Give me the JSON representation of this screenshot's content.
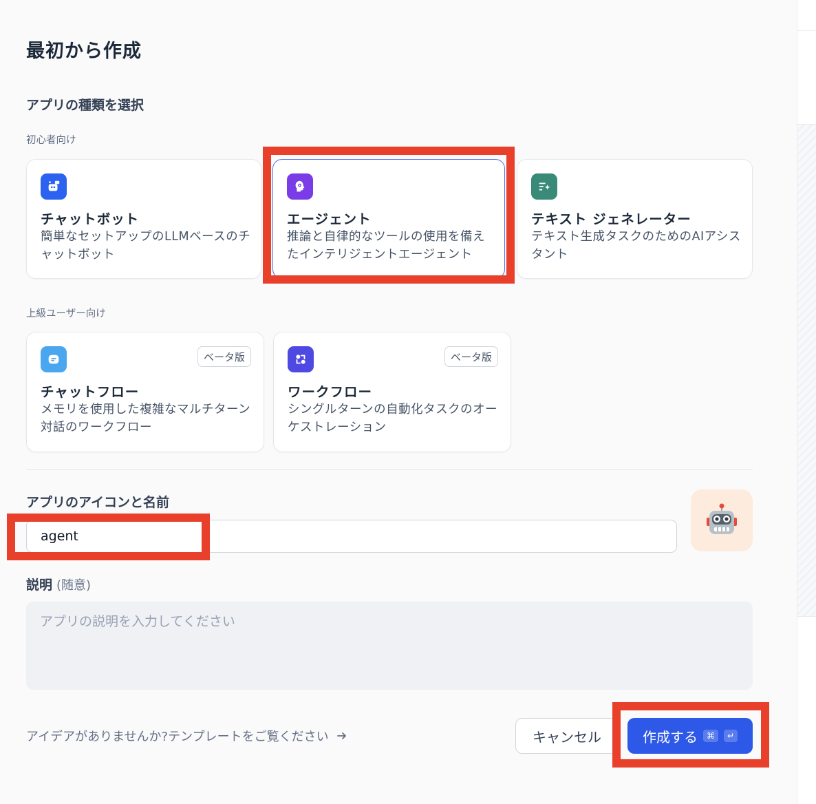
{
  "page": {
    "title": "最初から作成"
  },
  "app_type": {
    "heading": "アプリの種類を選択",
    "beginner_label": "初心者向け",
    "advanced_label": "上級ユーザー向け",
    "beginner_cards": [
      {
        "name": "チャットボット",
        "desc": "簡単なセットアップのLLMベースのチャットボット",
        "icon": "chatbot-icon",
        "color": "#2b63f0"
      },
      {
        "name": "エージェント",
        "desc": "推論と自律的なツールの使用を備えたインテリジェントエージェント",
        "icon": "agent-brain-icon",
        "color": "#7a3ce6"
      },
      {
        "name": "テキスト ジェネレーター",
        "desc": "テキスト生成タスクのためのAIアシスタント",
        "icon": "text-generator-icon",
        "color": "#3a8a7a"
      }
    ],
    "advanced_cards": [
      {
        "name": "チャットフロー",
        "desc": "メモリを使用した複雑なマルチターン対話のワークフロー",
        "badge": "ベータ版",
        "icon": "chatflow-icon",
        "color": "#4aa6ef"
      },
      {
        "name": "ワークフロー",
        "desc": "シングルターンの自動化タスクのオーケストレーション",
        "badge": "ベータ版",
        "icon": "workflow-icon",
        "color": "#4f49e3"
      }
    ]
  },
  "name_section": {
    "heading": "アプリのアイコンと名前",
    "value": "agent",
    "avatar_icon": "robot-emoji-icon",
    "avatar_emoji": "🤖"
  },
  "description": {
    "label": "説明",
    "optional": "(随意)",
    "placeholder": "アプリの説明を入力してください"
  },
  "footer": {
    "template_link": "アイデアがありませんか?テンプレートをご覧ください",
    "cancel": "キャンセル",
    "create": "作成する",
    "kbd_cmd": "⌘",
    "kbd_enter": "↵"
  },
  "colors": {
    "accent": "#2d58e8",
    "highlight": "#e8402a"
  }
}
